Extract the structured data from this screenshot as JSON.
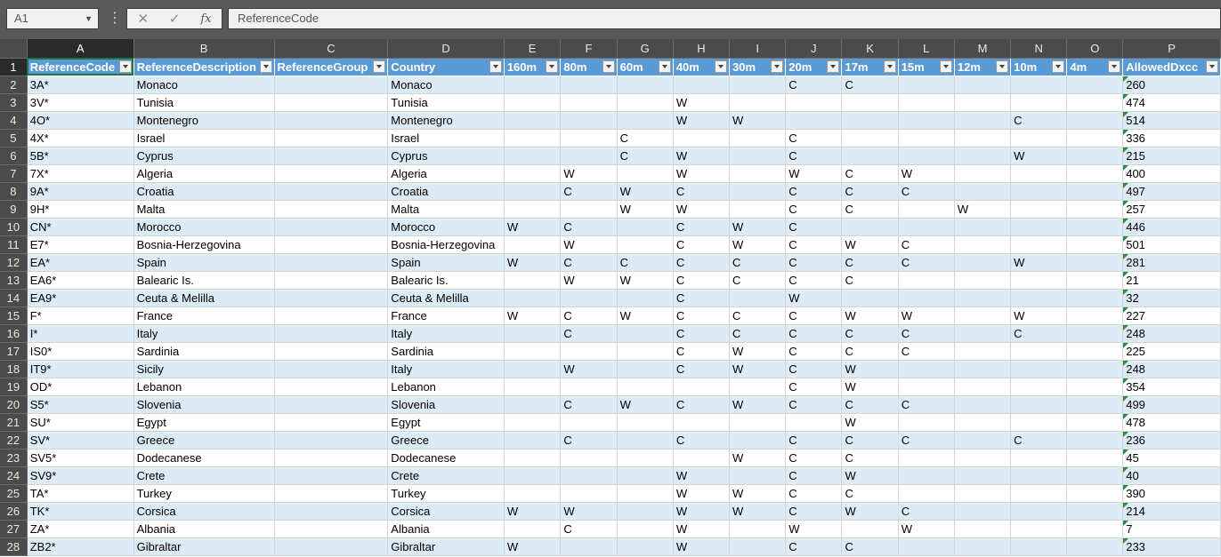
{
  "formula_bar": {
    "name_box": "A1",
    "formula": "ReferenceCode"
  },
  "columns": [
    "A",
    "B",
    "C",
    "D",
    "E",
    "F",
    "G",
    "H",
    "I",
    "J",
    "K",
    "L",
    "M",
    "N",
    "O",
    "P"
  ],
  "headers": [
    "ReferenceCode",
    "ReferenceDescription",
    "ReferenceGroup",
    "Country",
    "160m",
    "80m",
    "60m",
    "40m",
    "30m",
    "20m",
    "17m",
    "15m",
    "12m",
    "10m",
    "4m",
    "AllowedDxcc"
  ],
  "rows": [
    {
      "n": "2",
      "cells": [
        "3A*",
        "Monaco",
        "",
        "Monaco",
        "",
        "",
        "",
        "",
        "",
        "C",
        "C",
        "",
        "",
        "",
        "",
        "260"
      ]
    },
    {
      "n": "3",
      "cells": [
        "3V*",
        "Tunisia",
        "",
        "Tunisia",
        "",
        "",
        "",
        "W",
        "",
        "",
        "",
        "",
        "",
        "",
        "",
        "474"
      ]
    },
    {
      "n": "4",
      "cells": [
        "4O*",
        "Montenegro",
        "",
        "Montenegro",
        "",
        "",
        "",
        "W",
        "W",
        "",
        "",
        "",
        "",
        "C",
        "",
        "514"
      ]
    },
    {
      "n": "5",
      "cells": [
        "4X*",
        "Israel",
        "",
        "Israel",
        "",
        "",
        "C",
        "",
        "",
        "C",
        "",
        "",
        "",
        "",
        "",
        "336"
      ]
    },
    {
      "n": "6",
      "cells": [
        "5B*",
        "Cyprus",
        "",
        "Cyprus",
        "",
        "",
        "C",
        "W",
        "",
        "C",
        "",
        "",
        "",
        "W",
        "",
        "215"
      ]
    },
    {
      "n": "7",
      "cells": [
        "7X*",
        "Algeria",
        "",
        "Algeria",
        "",
        "W",
        "",
        "W",
        "",
        "W",
        "C",
        "W",
        "",
        "",
        "",
        "400"
      ]
    },
    {
      "n": "8",
      "cells": [
        "9A*",
        "Croatia",
        "",
        "Croatia",
        "",
        "C",
        "W",
        "C",
        "",
        "C",
        "C",
        "C",
        "",
        "",
        "",
        "497"
      ]
    },
    {
      "n": "9",
      "cells": [
        "9H*",
        "Malta",
        "",
        "Malta",
        "",
        "",
        "W",
        "W",
        "",
        "C",
        "C",
        "",
        "W",
        "",
        "",
        "257"
      ]
    },
    {
      "n": "10",
      "cells": [
        "CN*",
        "Morocco",
        "",
        "Morocco",
        "W",
        "C",
        "",
        "C",
        "W",
        "C",
        "",
        "",
        "",
        "",
        "",
        "446"
      ]
    },
    {
      "n": "11",
      "cells": [
        "E7*",
        "Bosnia-Herzegovina",
        "",
        "Bosnia-Herzegovina",
        "",
        "W",
        "",
        "C",
        "W",
        "C",
        "W",
        "C",
        "",
        "",
        "",
        "501"
      ]
    },
    {
      "n": "12",
      "cells": [
        "EA*",
        "Spain",
        "",
        "Spain",
        "W",
        "C",
        "C",
        "C",
        "C",
        "C",
        "C",
        "C",
        "",
        "W",
        "",
        "281"
      ]
    },
    {
      "n": "13",
      "cells": [
        "EA6*",
        "Balearic Is.",
        "",
        "Balearic Is.",
        "",
        "W",
        "W",
        "C",
        "C",
        "C",
        "C",
        "",
        "",
        "",
        "",
        "21"
      ]
    },
    {
      "n": "14",
      "cells": [
        "EA9*",
        "Ceuta & Melilla",
        "",
        "Ceuta & Melilla",
        "",
        "",
        "",
        "C",
        "",
        "W",
        "",
        "",
        "",
        "",
        "",
        "32"
      ]
    },
    {
      "n": "15",
      "cells": [
        "F*",
        "France",
        "",
        "France",
        "W",
        "C",
        "W",
        "C",
        "C",
        "C",
        "W",
        "W",
        "",
        "W",
        "",
        "227"
      ]
    },
    {
      "n": "16",
      "cells": [
        "I*",
        "Italy",
        "",
        "Italy",
        "",
        "C",
        "",
        "C",
        "C",
        "C",
        "C",
        "C",
        "",
        "C",
        "",
        "248"
      ]
    },
    {
      "n": "17",
      "cells": [
        "IS0*",
        "Sardinia",
        "",
        "Sardinia",
        "",
        "",
        "",
        "C",
        "W",
        "C",
        "C",
        "C",
        "",
        "",
        "",
        "225"
      ]
    },
    {
      "n": "18",
      "cells": [
        "IT9*",
        "Sicily",
        "",
        "Italy",
        "",
        "W",
        "",
        "C",
        "W",
        "C",
        "W",
        "",
        "",
        "",
        "",
        "248"
      ]
    },
    {
      "n": "19",
      "cells": [
        "OD*",
        "Lebanon",
        "",
        "Lebanon",
        "",
        "",
        "",
        "",
        "",
        "C",
        "W",
        "",
        "",
        "",
        "",
        "354"
      ]
    },
    {
      "n": "20",
      "cells": [
        "S5*",
        "Slovenia",
        "",
        "Slovenia",
        "",
        "C",
        "W",
        "C",
        "W",
        "C",
        "C",
        "C",
        "",
        "",
        "",
        "499"
      ]
    },
    {
      "n": "21",
      "cells": [
        "SU*",
        "Egypt",
        "",
        "Egypt",
        "",
        "",
        "",
        "",
        "",
        "",
        "W",
        "",
        "",
        "",
        "",
        "478"
      ]
    },
    {
      "n": "22",
      "cells": [
        "SV*",
        "Greece",
        "",
        "Greece",
        "",
        "C",
        "",
        "C",
        "",
        "C",
        "C",
        "C",
        "",
        "C",
        "",
        "236"
      ]
    },
    {
      "n": "23",
      "cells": [
        "SV5*",
        "Dodecanese",
        "",
        "Dodecanese",
        "",
        "",
        "",
        "",
        "W",
        "C",
        "C",
        "",
        "",
        "",
        "",
        "45"
      ]
    },
    {
      "n": "24",
      "cells": [
        "SV9*",
        "Crete",
        "",
        "Crete",
        "",
        "",
        "",
        "W",
        "",
        "C",
        "W",
        "",
        "",
        "",
        "",
        "40"
      ]
    },
    {
      "n": "25",
      "cells": [
        "TA*",
        "Turkey",
        "",
        "Turkey",
        "",
        "",
        "",
        "W",
        "W",
        "C",
        "C",
        "",
        "",
        "",
        "",
        "390"
      ]
    },
    {
      "n": "26",
      "cells": [
        "TK*",
        "Corsica",
        "",
        "Corsica",
        "W",
        "W",
        "",
        "W",
        "W",
        "C",
        "W",
        "C",
        "",
        "",
        "",
        "214"
      ]
    },
    {
      "n": "27",
      "cells": [
        "ZA*",
        "Albania",
        "",
        "Albania",
        "",
        "C",
        "",
        "W",
        "",
        "W",
        "",
        "W",
        "",
        "",
        "",
        "7"
      ]
    },
    {
      "n": "28",
      "cells": [
        "ZB2*",
        "Gibraltar",
        "",
        "Gibraltar",
        "W",
        "",
        "",
        "W",
        "",
        "C",
        "C",
        "",
        "",
        "",
        "",
        "233"
      ]
    }
  ]
}
